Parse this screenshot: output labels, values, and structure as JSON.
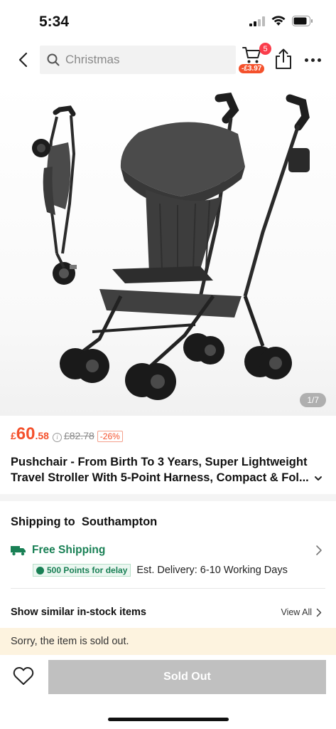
{
  "status_bar": {
    "time": "5:34"
  },
  "header": {
    "search_placeholder": "Christmas",
    "cart_count": "5",
    "cart_price_tag": "-£3.97"
  },
  "gallery": {
    "counter": "1/7"
  },
  "price": {
    "currency": "£",
    "integer": "60",
    "decimal": ".58",
    "original": "£82.78",
    "discount": "-26%"
  },
  "product": {
    "title": "Pushchair - From Birth To 3 Years, Super Lightweight Travel Stroller With 5-Point Harness, Compact & Fol..."
  },
  "shipping": {
    "title": "Shipping to",
    "destination": "Southampton",
    "free_label": "Free Shipping",
    "points_badge": "500 Points for delay",
    "estimate": "Est. Delivery: 6-10 Working Days"
  },
  "similar": {
    "title": "Show similar in-stock items",
    "view_all": "View All"
  },
  "banner": {
    "text": "Sorry, the item is sold out."
  },
  "bottom": {
    "button_label": "Sold Out"
  },
  "colors": {
    "price_orange": "#f4512c",
    "shipping_green": "#198055",
    "badge_red": "#fa3d4b",
    "banner_bg": "#fdf3df",
    "disabled_button": "#c0c0c0"
  }
}
